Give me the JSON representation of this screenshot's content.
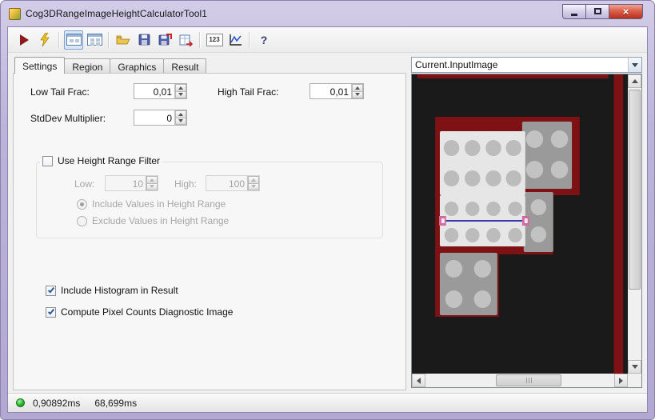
{
  "window": {
    "title": "Cog3DRangeImageHeightCalculatorTool1",
    "close_glyph": "×"
  },
  "toolbar": {
    "number_icon_label": "123",
    "help_label": "?"
  },
  "tabs": {
    "items": [
      "Settings",
      "Region",
      "Graphics",
      "Result"
    ],
    "active": "Settings"
  },
  "settings": {
    "low_tail": {
      "label": "Low Tail Frac:",
      "value": "0,01"
    },
    "high_tail": {
      "label": "High Tail Frac:",
      "value": "0,01"
    },
    "stddev": {
      "label": "StdDev Multiplier:",
      "value": "0"
    },
    "height_filter": {
      "label": "Use Height Range Filter",
      "checked": false,
      "low": {
        "label": "Low:",
        "value": "10"
      },
      "high": {
        "label": "High:",
        "value": "100"
      },
      "include_radio": {
        "label": "Include Values in Height Range",
        "selected": true
      },
      "exclude_radio": {
        "label": "Exclude Values in Height Range",
        "selected": false
      }
    },
    "include_histogram": {
      "label": "Include Histogram in Result",
      "checked": true
    },
    "compute_pixel_counts": {
      "label": "Compute Pixel Counts Diagnostic Image",
      "checked": true
    }
  },
  "image_panel": {
    "selector_value": "Current.InputImage",
    "colors": {
      "background": "#1a1a1a",
      "red_overlay": "#7e1113",
      "gray_block": "#9a9a9a",
      "light_block": "#e6e6e6",
      "stud_on_gray": "#c2c2c2",
      "stud_on_light": "#bcbcbc",
      "measure_line": "#3a3aae",
      "marker": "#cf6b9e"
    }
  },
  "status_bar": {
    "process_time": "0,90892ms",
    "total_time": "68,699ms"
  }
}
